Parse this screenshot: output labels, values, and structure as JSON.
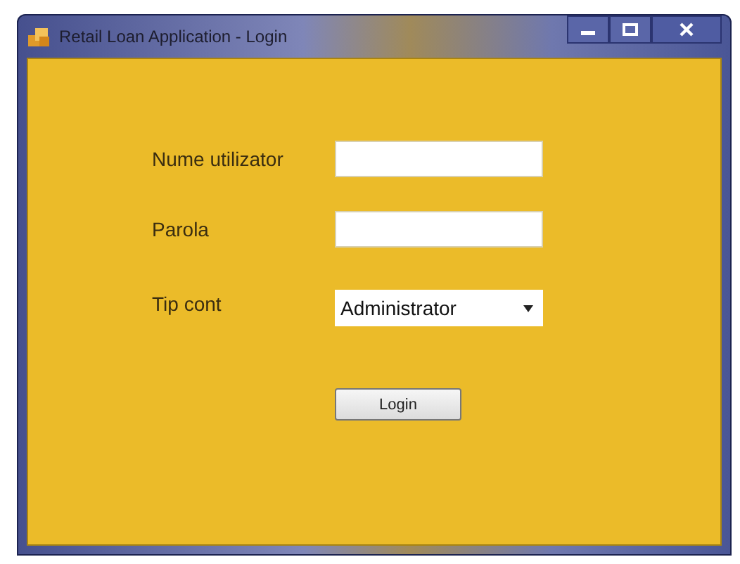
{
  "window": {
    "title": "Retail Loan Application - Login"
  },
  "form": {
    "fields": [
      {
        "kind": "text",
        "label": "Nume utilizator"
      },
      {
        "kind": "password",
        "label": "Parola"
      },
      {
        "kind": "select",
        "label": "Tip cont",
        "value": "Administrator"
      }
    ],
    "buttons": [
      "Login"
    ]
  }
}
